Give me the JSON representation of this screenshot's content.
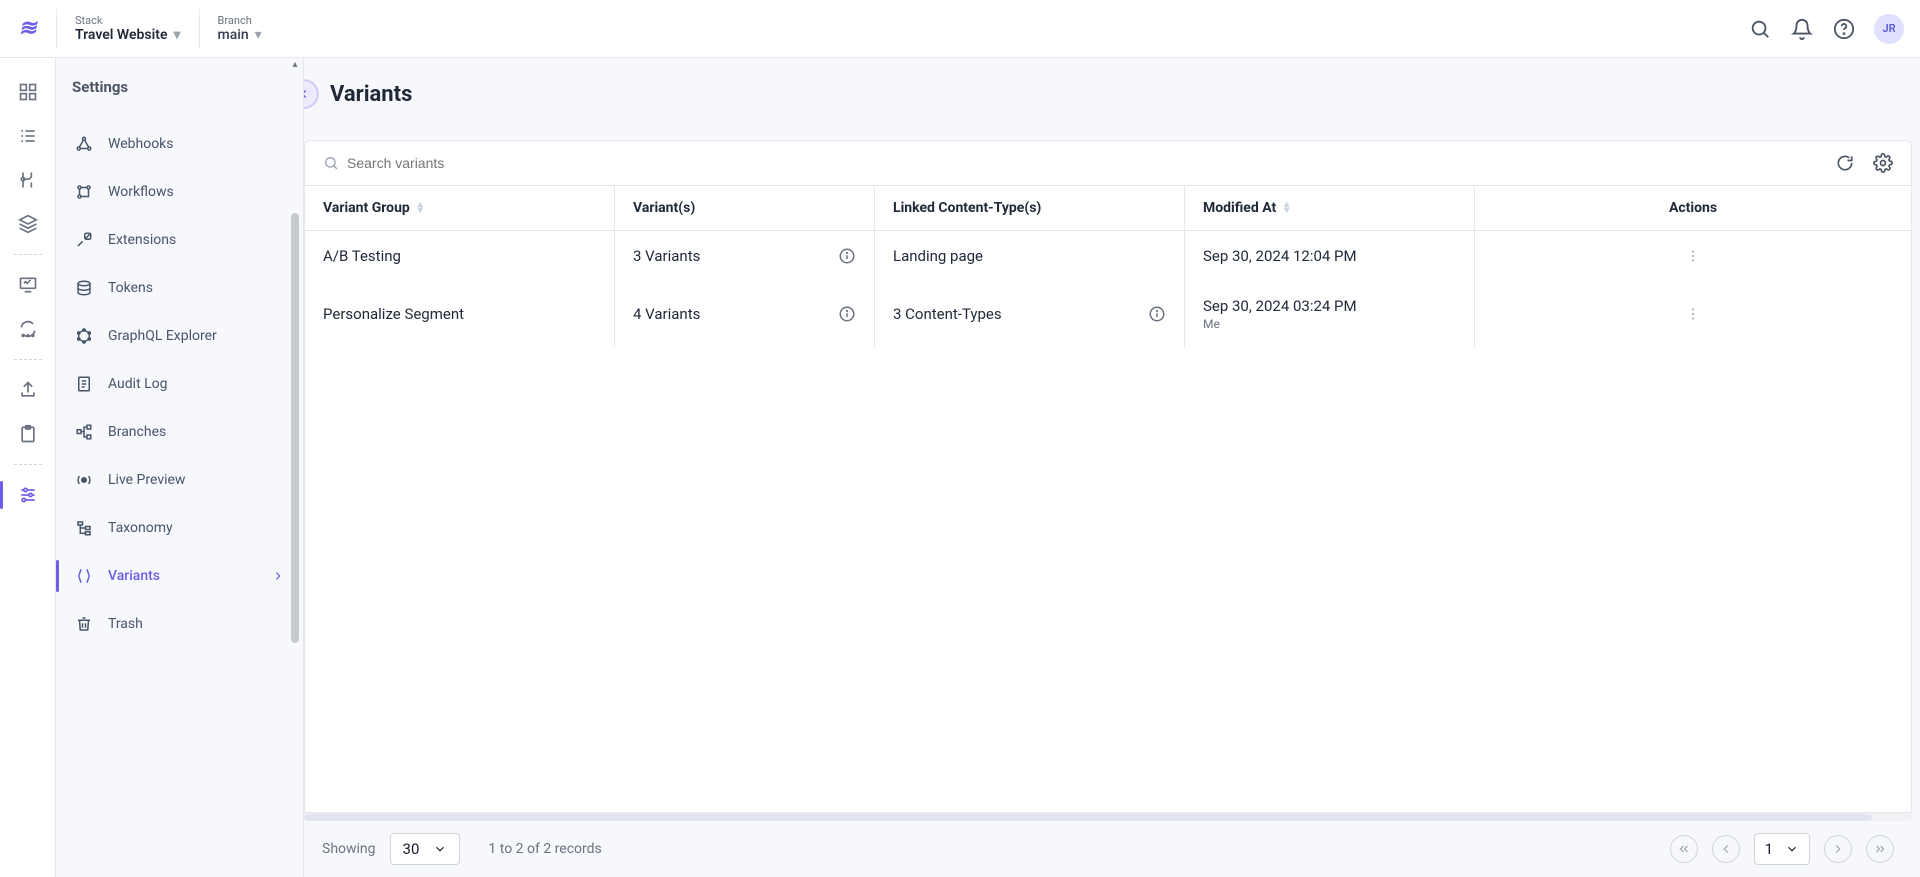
{
  "header": {
    "stack_label": "Stack",
    "stack_value": "Travel Website",
    "branch_label": "Branch",
    "branch_value": "main",
    "avatar_initials": "JR"
  },
  "sidebar": {
    "title": "Settings",
    "items": [
      {
        "label": "Webhooks"
      },
      {
        "label": "Workflows"
      },
      {
        "label": "Extensions"
      },
      {
        "label": "Tokens"
      },
      {
        "label": "GraphQL Explorer"
      },
      {
        "label": "Audit Log"
      },
      {
        "label": "Branches"
      },
      {
        "label": "Live Preview"
      },
      {
        "label": "Taxonomy"
      },
      {
        "label": "Variants"
      },
      {
        "label": "Trash"
      }
    ]
  },
  "page": {
    "title": "Variants",
    "search_placeholder": "Search variants"
  },
  "table": {
    "headers": {
      "group": "Variant Group",
      "variants": "Variant(s)",
      "content_types": "Linked Content-Type(s)",
      "modified": "Modified At",
      "actions": "Actions"
    },
    "rows": [
      {
        "group": "A/B Testing",
        "variants": "3 Variants",
        "content_types": "Landing page",
        "ct_info": false,
        "modified": "Sep 30, 2024 12:04 PM",
        "modified_by": ""
      },
      {
        "group": "Personalize Segment",
        "variants": "4 Variants",
        "content_types": "3 Content-Types",
        "ct_info": true,
        "modified": "Sep 30, 2024 03:24 PM",
        "modified_by": "Me"
      }
    ]
  },
  "pager": {
    "showing_label": "Showing",
    "page_size": "30",
    "records_info": "1 to 2 of 2 records",
    "current_page": "1"
  }
}
